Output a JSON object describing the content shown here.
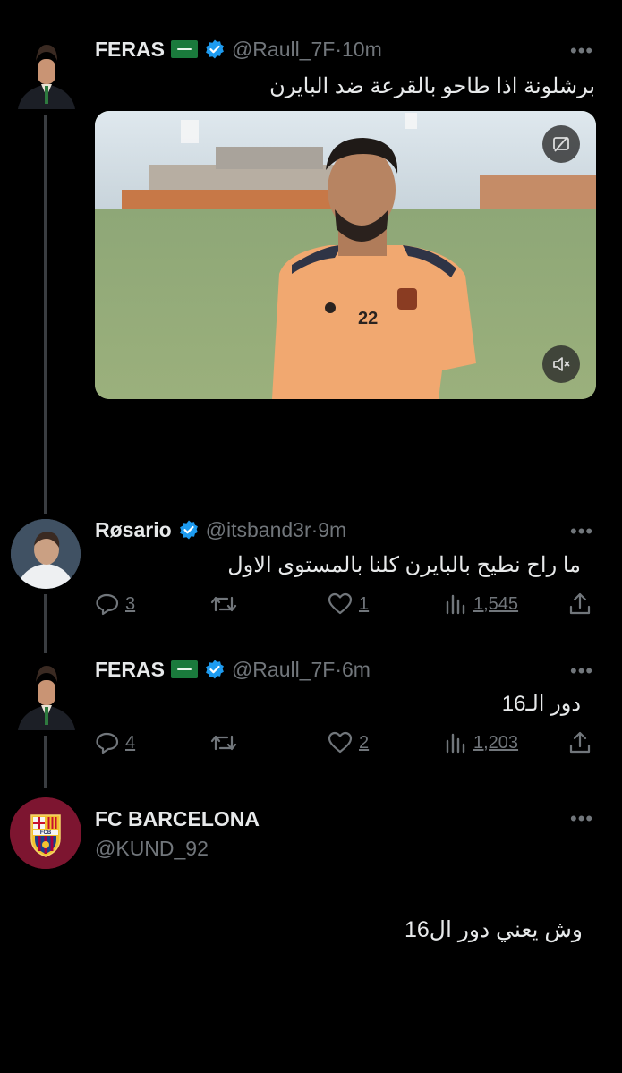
{
  "tweets": [
    {
      "name": "FERAS",
      "handle": "@Raull_7F",
      "time": "·10m",
      "text": "برشلونة اذا طاحو بالقرعة ضد البايرن",
      "player_number": "22"
    },
    {
      "name": "Røsario",
      "handle": "@itsband3r",
      "time": "·9m",
      "text": "ما راح نطيح بالبايرن كلنا بالمستوى الاول",
      "replies": "3",
      "retweets": "",
      "likes": "1",
      "views": "1,545"
    },
    {
      "name": "FERAS",
      "handle": "@Raull_7F",
      "time": "·6m",
      "text": "دور الـ16",
      "replies": "4",
      "retweets": "",
      "likes": "2",
      "views": "1,203"
    }
  ],
  "profile": {
    "name": "FC BARCELONA",
    "handle": "@KUND_92",
    "text": "وش يعني دور ال16",
    "crest_letters": "FCB"
  },
  "more_label": "•••",
  "colors": {
    "verified": "#1d9bf0",
    "muted": "#71767b",
    "flag": "#1a7a3c"
  }
}
